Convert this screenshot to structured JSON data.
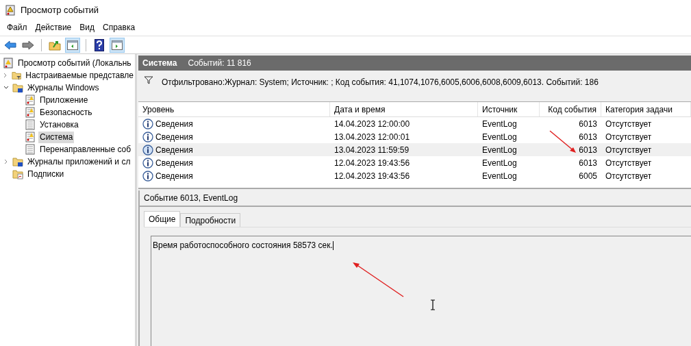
{
  "window": {
    "title": "Просмотр событий"
  },
  "menu": [
    "Файл",
    "Действие",
    "Вид",
    "Справка"
  ],
  "tree": {
    "label": "Просмотр событий (Локальнь",
    "children": [
      {
        "label": "Настраиваемые представле",
        "kind": "filter-folder",
        "expanded": false,
        "selected": false
      },
      {
        "label": "Журналы Windows",
        "kind": "folder",
        "expanded": true,
        "selected": false,
        "children": [
          {
            "label": "Приложение",
            "kind": "log-warn",
            "selected": false
          },
          {
            "label": "Безопасность",
            "kind": "log-warn",
            "selected": false
          },
          {
            "label": "Установка",
            "kind": "log",
            "selected": false
          },
          {
            "label": "Система",
            "kind": "log-warn",
            "selected": true
          },
          {
            "label": "Перенаправленные соб",
            "kind": "log",
            "selected": false
          }
        ]
      },
      {
        "label": "Журналы приложений и сл",
        "kind": "folder",
        "expanded": false,
        "selected": false
      },
      {
        "label": "Подписки",
        "kind": "subs",
        "selected": false
      }
    ]
  },
  "log_header": {
    "title": "Система",
    "count": "Событий: 11 816"
  },
  "filter": "Отфильтровано:Журнал: System; Источник: ; Код события: 41,1074,1076,6005,6006,6008,6009,6013. Событий: 186",
  "table": {
    "columns": [
      "Уровень",
      "Дата и время",
      "Источник",
      "Код события",
      "Категория задачи"
    ],
    "rows": [
      {
        "level": "Сведения",
        "date": "14.04.2023 12:00:00",
        "source": "EventLog",
        "code": "6013",
        "category": "Отсутствует",
        "selected": false
      },
      {
        "level": "Сведения",
        "date": "13.04.2023 12:00:01",
        "source": "EventLog",
        "code": "6013",
        "category": "Отсутствует",
        "selected": false
      },
      {
        "level": "Сведения",
        "date": "13.04.2023 11:59:59",
        "source": "EventLog",
        "code": "6013",
        "category": "Отсутствует",
        "selected": true
      },
      {
        "level": "Сведения",
        "date": "12.04.2023 19:43:56",
        "source": "EventLog",
        "code": "6013",
        "category": "Отсутствует",
        "selected": false
      },
      {
        "level": "Сведения",
        "date": "12.04.2023 19:43:56",
        "source": "EventLog",
        "code": "6005",
        "category": "Отсутствует",
        "selected": false
      }
    ]
  },
  "details": {
    "title": "Событие 6013, EventLog",
    "tabs": [
      {
        "label": "Общие",
        "selected": true
      },
      {
        "label": "Подробности",
        "selected": false
      }
    ],
    "description": "Время работоспособного состояния 58573 сек."
  }
}
